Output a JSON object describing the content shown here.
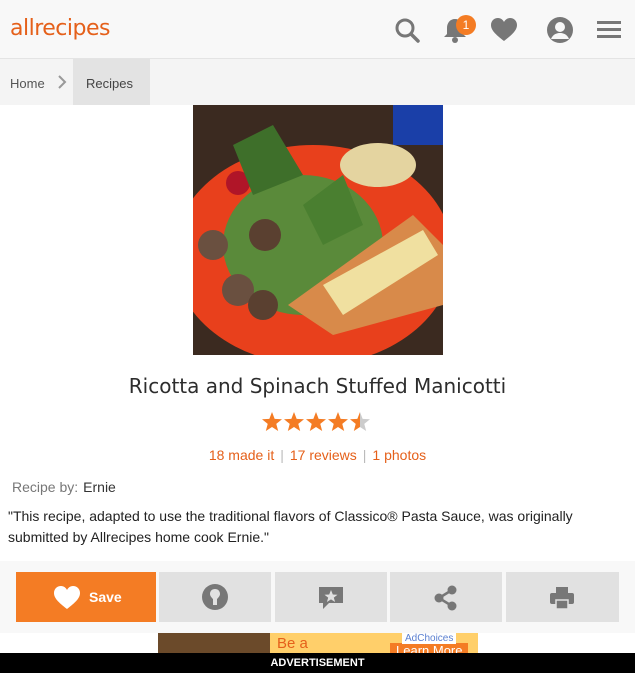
{
  "header": {
    "logo_text": "allrecipes",
    "notification_count": "1",
    "icons": [
      "search-icon",
      "bell-icon",
      "heart-icon",
      "user-icon",
      "menu-icon"
    ]
  },
  "breadcrumb": {
    "home": "Home",
    "current": "Recipes"
  },
  "recipe": {
    "title": "Ricotta and Spinach Stuffed Manicotti",
    "rating": 4.5,
    "rating_max": 5,
    "made_it": "18 made it",
    "reviews": "17 reviews",
    "photos": "1 photos",
    "by_label": "Recipe by:",
    "author": "Ernie",
    "description": "\"This recipe, adapted to use the traditional flavors of Classico® Pasta Sauce, was originally submitted by Allrecipes home cook Ernie.\""
  },
  "actions": {
    "save_label": "Save",
    "icons": [
      "heart-icon",
      "made-it-icon",
      "review-icon",
      "share-icon",
      "print-icon"
    ]
  },
  "ad": {
    "headline": "Be a",
    "choices": "AdChoices",
    "cta": "Learn More",
    "label": "ADVERTISEMENT"
  },
  "colors": {
    "brand": "#f47c24",
    "link": "#e5601a"
  }
}
